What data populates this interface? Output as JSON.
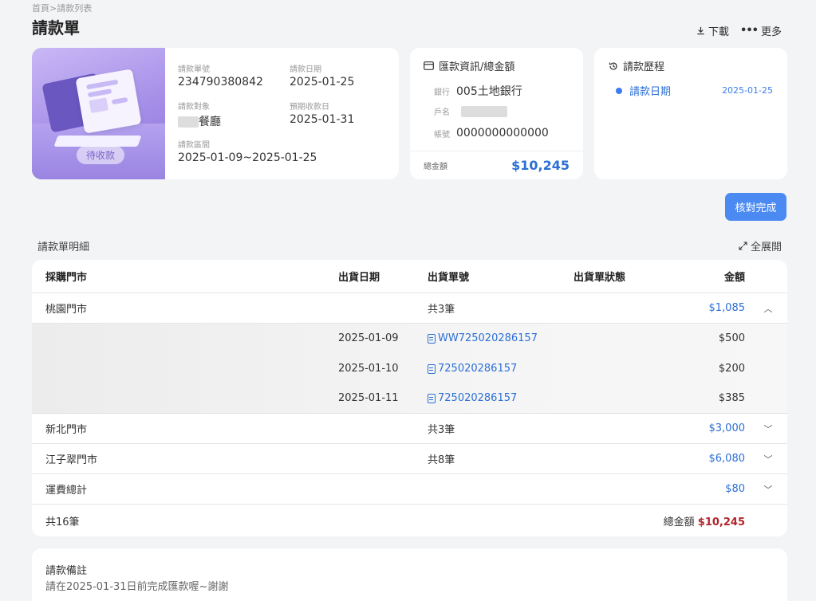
{
  "breadcrumb": "首頁>請款列表",
  "page_title": "請款單",
  "actions": {
    "download": "下載",
    "more": "更多"
  },
  "invoice": {
    "status": "待收款",
    "no_label": "請款單號",
    "no": "234790380842",
    "date_label": "請款日期",
    "date": "2025-01-25",
    "target_label": "請款對象",
    "target": "餐廳",
    "due_label": "預期收款日",
    "due": "2025-01-31",
    "period_label": "請款區間",
    "period": "2025-01-09~2025-01-25"
  },
  "remit": {
    "title": "匯款資訊/總金額",
    "bank_label": "銀行",
    "bank": "005土地銀行",
    "name_label": "戶名",
    "account_label": "帳號",
    "account": "0000000000000",
    "total_label": "總金額",
    "total": "$10,245"
  },
  "history": {
    "title": "請款歷程",
    "items": [
      {
        "label": "請款日期",
        "date": "2025-01-25"
      }
    ]
  },
  "confirm_button": "核對完成",
  "detail": {
    "title": "請款單明細",
    "expand": "全展開",
    "columns": [
      "採購門市",
      "出貨日期",
      "出貨單號",
      "出貨單狀態",
      "金額"
    ],
    "groups": [
      {
        "store": "桃園門市",
        "count": "共3筆",
        "amount": "$1,085",
        "expanded": true,
        "rows": [
          {
            "date": "2025-01-09",
            "no": "WW725020286157",
            "amount": "$500"
          },
          {
            "date": "2025-01-10",
            "no": "725020286157",
            "amount": "$200"
          },
          {
            "date": "2025-01-11",
            "no": "725020286157",
            "amount": "$385"
          }
        ]
      },
      {
        "store": "新北門市",
        "count": "共3筆",
        "amount": "$3,000",
        "expanded": false
      },
      {
        "store": "江子翠門市",
        "count": "共8筆",
        "amount": "$6,080",
        "expanded": false
      },
      {
        "store": "運費總計",
        "count": "",
        "amount": "$80",
        "expanded": false
      }
    ],
    "footer": {
      "count": "共16筆",
      "total_label": "總金額",
      "total": "$10,245"
    }
  },
  "note": {
    "label": "請款備註",
    "text": "請在2025-01-31日前完成匯款喔~謝謝"
  },
  "colors": {
    "accent": "#4b8af2",
    "link": "#2b6fd6",
    "total_red": "#b3242b",
    "hero_purple": "#a48ee8"
  }
}
